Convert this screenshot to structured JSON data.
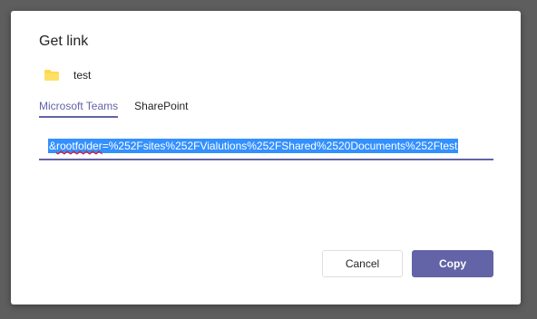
{
  "dialog": {
    "title": "Get link"
  },
  "file": {
    "name": "test",
    "icon": "folder-icon",
    "icon_color": "#ffd84f"
  },
  "tabs": [
    {
      "label": "Microsoft Teams",
      "active": true
    },
    {
      "label": "SharePoint",
      "active": false
    }
  ],
  "link": {
    "value": "&rootfolder=%252Fsites%252FVialutions%252FShared%2520Documents%252Ftest",
    "value_pre": "&",
    "value_misspelled": "rootfolder",
    "value_post": "=%252Fsites%252FVialutions%252FShared%2520Documents%252Ftest"
  },
  "buttons": {
    "cancel_label": "Cancel",
    "copy_label": "Copy"
  },
  "colors": {
    "accent": "#6264a7",
    "selection": "#3390ff",
    "backdrop": "#5e5e5e"
  }
}
